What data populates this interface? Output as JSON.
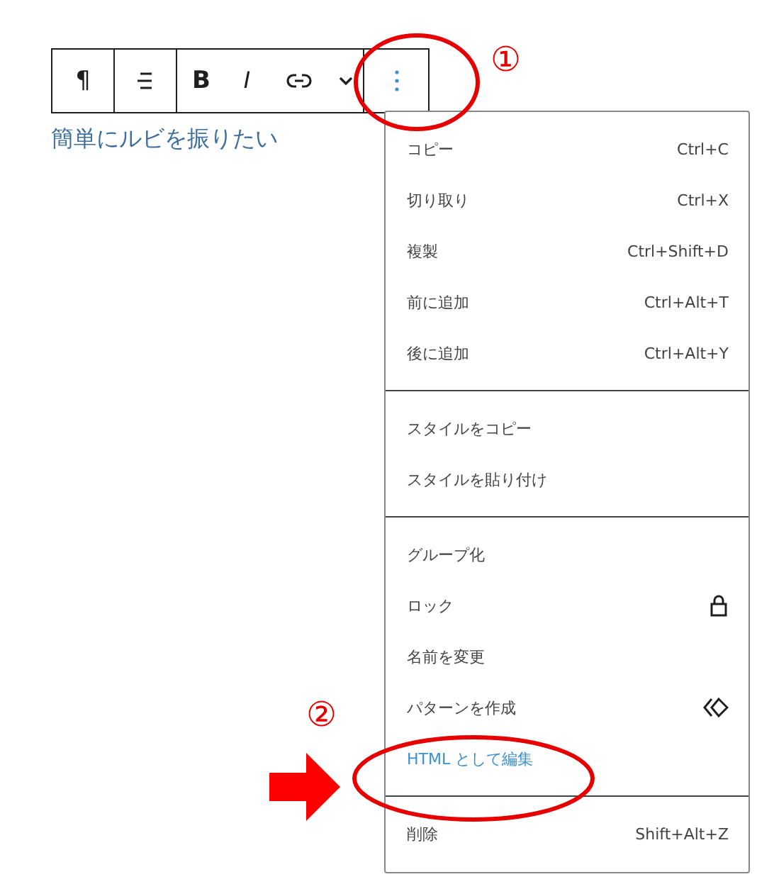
{
  "toolbar": [
    [
      {
        "kind": "glyph",
        "text": "¶"
      }
    ],
    [
      {
        "kind": "align"
      }
    ],
    [
      {
        "kind": "bold",
        "text": "B"
      },
      {
        "kind": "italic",
        "text": "I"
      },
      {
        "kind": "link"
      },
      {
        "kind": "chevron"
      }
    ],
    [
      {
        "kind": "more"
      }
    ]
  ],
  "paragraph": "簡単にルビを振りたい",
  "menu": [
    [
      {
        "label": "コピー",
        "shortcut": "Ctrl+C",
        "highlighted": false
      },
      {
        "label": "切り取り",
        "shortcut": "Ctrl+X",
        "highlighted": false
      },
      {
        "label": "複製",
        "shortcut": "Ctrl+Shift+D",
        "highlighted": false
      },
      {
        "label": "前に追加",
        "shortcut": "Ctrl+Alt+T",
        "highlighted": false
      },
      {
        "label": "後に追加",
        "shortcut": "Ctrl+Alt+Y",
        "highlighted": false
      }
    ],
    [
      {
        "label": "スタイルをコピー",
        "highlighted": false
      },
      {
        "label": "スタイルを貼り付け",
        "highlighted": false
      }
    ],
    [
      {
        "label": "グループ化",
        "highlighted": false
      },
      {
        "label": "ロック",
        "kind": "lock",
        "highlighted": false
      },
      {
        "label": "名前を変更",
        "highlighted": false
      },
      {
        "label": "パターンを作成",
        "kind": "pattern",
        "highlighted": false
      },
      {
        "label": "HTML として編集",
        "highlighted": true
      }
    ],
    [
      {
        "label": "削除",
        "shortcut": "Shift+Alt+Z",
        "highlighted": false
      }
    ]
  ],
  "annotations": [
    {
      "kind": "circled_number",
      "text": "①"
    },
    {
      "kind": "circled_number",
      "text": "②"
    }
  ]
}
